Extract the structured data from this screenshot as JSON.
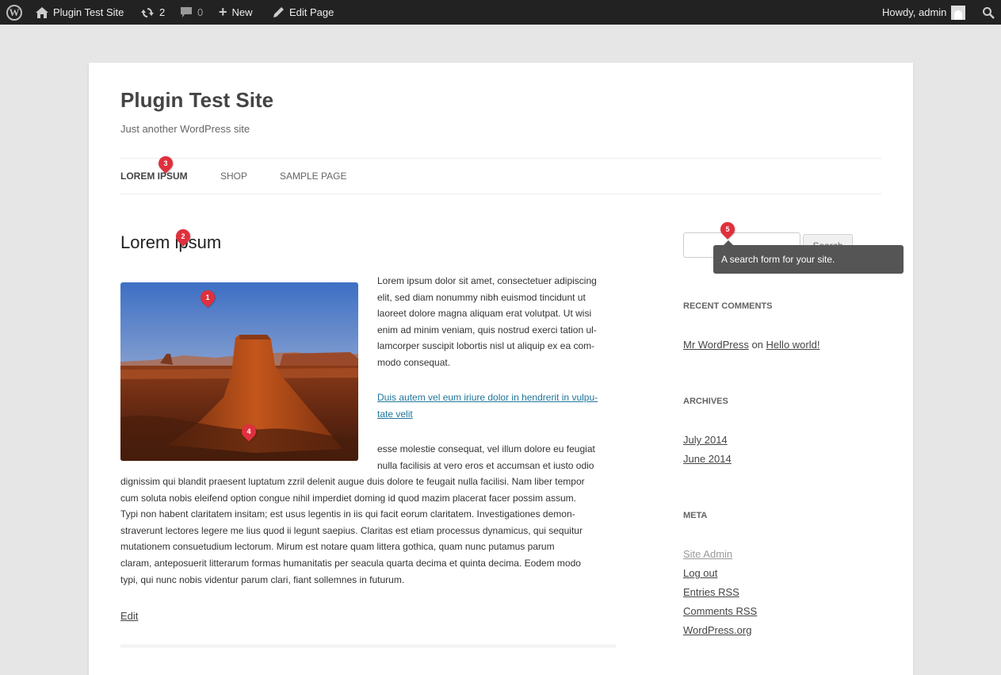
{
  "admin_bar": {
    "site_name": "Plugin Test Site",
    "updates_count": "2",
    "comments_count": "0",
    "new_label": "New",
    "edit_page_label": "Edit Page",
    "howdy": "Howdy, admin"
  },
  "site": {
    "title": "Plugin Test Site",
    "tagline": "Just another WordPress site"
  },
  "nav": {
    "items": [
      {
        "label": "LOREM IPSUM"
      },
      {
        "label": "SHOP"
      },
      {
        "label": "SAMPLE PAGE"
      }
    ]
  },
  "post": {
    "title": "Lorem ipsum",
    "p1": [
      "Lorem ipsum dolor sit amet, consectetuer adipiscing",
      "elit, sed diam nonummy nibh euismod tincidunt ut",
      "laoreet dolore magna aliquam erat volutpat. Ut wisi",
      "enim ad minim veniam, quis nostrud exerci tation ul-",
      "lamcorper suscipit lobortis nisl ut aliquip ex ea com-",
      "modo consequat."
    ],
    "link_lines": [
      "Duis autem vel eum iriure dolor in hendrerit in vulpu-",
      "tate velit"
    ],
    "p3_short": [
      "esse molestie consequat, vel illum dolore eu feugiat",
      "nulla facilisis at vero eros et accumsan et iusto odio"
    ],
    "p3_full": [
      "dignissim qui blandit praesent luptatum zzril delenit augue duis dolore te feugait nulla facilisi. Nam liber tempor",
      "cum soluta nobis eleifend option congue nihil imperdiet doming id quod mazim placerat facer possim assum.",
      "Typi non habent claritatem insitam; est usus legentis in iis qui facit eorum claritatem. Investigationes demon-",
      "straverunt lectores legere me lius quod ii legunt saepius. Claritas est etiam processus dynamicus, qui sequitur",
      "mutationem consuetudium lectorum. Mirum est notare quam littera gothica, quam nunc putamus parum",
      "claram, anteposuerit litterarum formas humanitatis per seacula quarta decima et quinta decima. Eodem modo",
      "typi, qui nunc nobis videntur parum clari, fiant sollemnes in futurum."
    ],
    "edit_label": "Edit"
  },
  "sidebar": {
    "search_button": "Search",
    "tooltip": "A search form for your site.",
    "recent_comments_title": "RECENT COMMENTS",
    "comment_author": "Mr WordPress",
    "comment_on": "on",
    "comment_post": "Hello world!",
    "archives_title": "ARCHIVES",
    "archives": [
      "July 2014",
      "June 2014"
    ],
    "meta_title": "META",
    "meta_links": [
      "Site Admin",
      "Log out",
      "Entries RSS",
      "Comments RSS",
      "WordPress.org"
    ]
  },
  "markers": [
    "1",
    "2",
    "3",
    "4",
    "5"
  ],
  "colors": {
    "admin_bar_bg": "#222222",
    "marker": "#e0303d",
    "link_blue": "#21759b"
  }
}
